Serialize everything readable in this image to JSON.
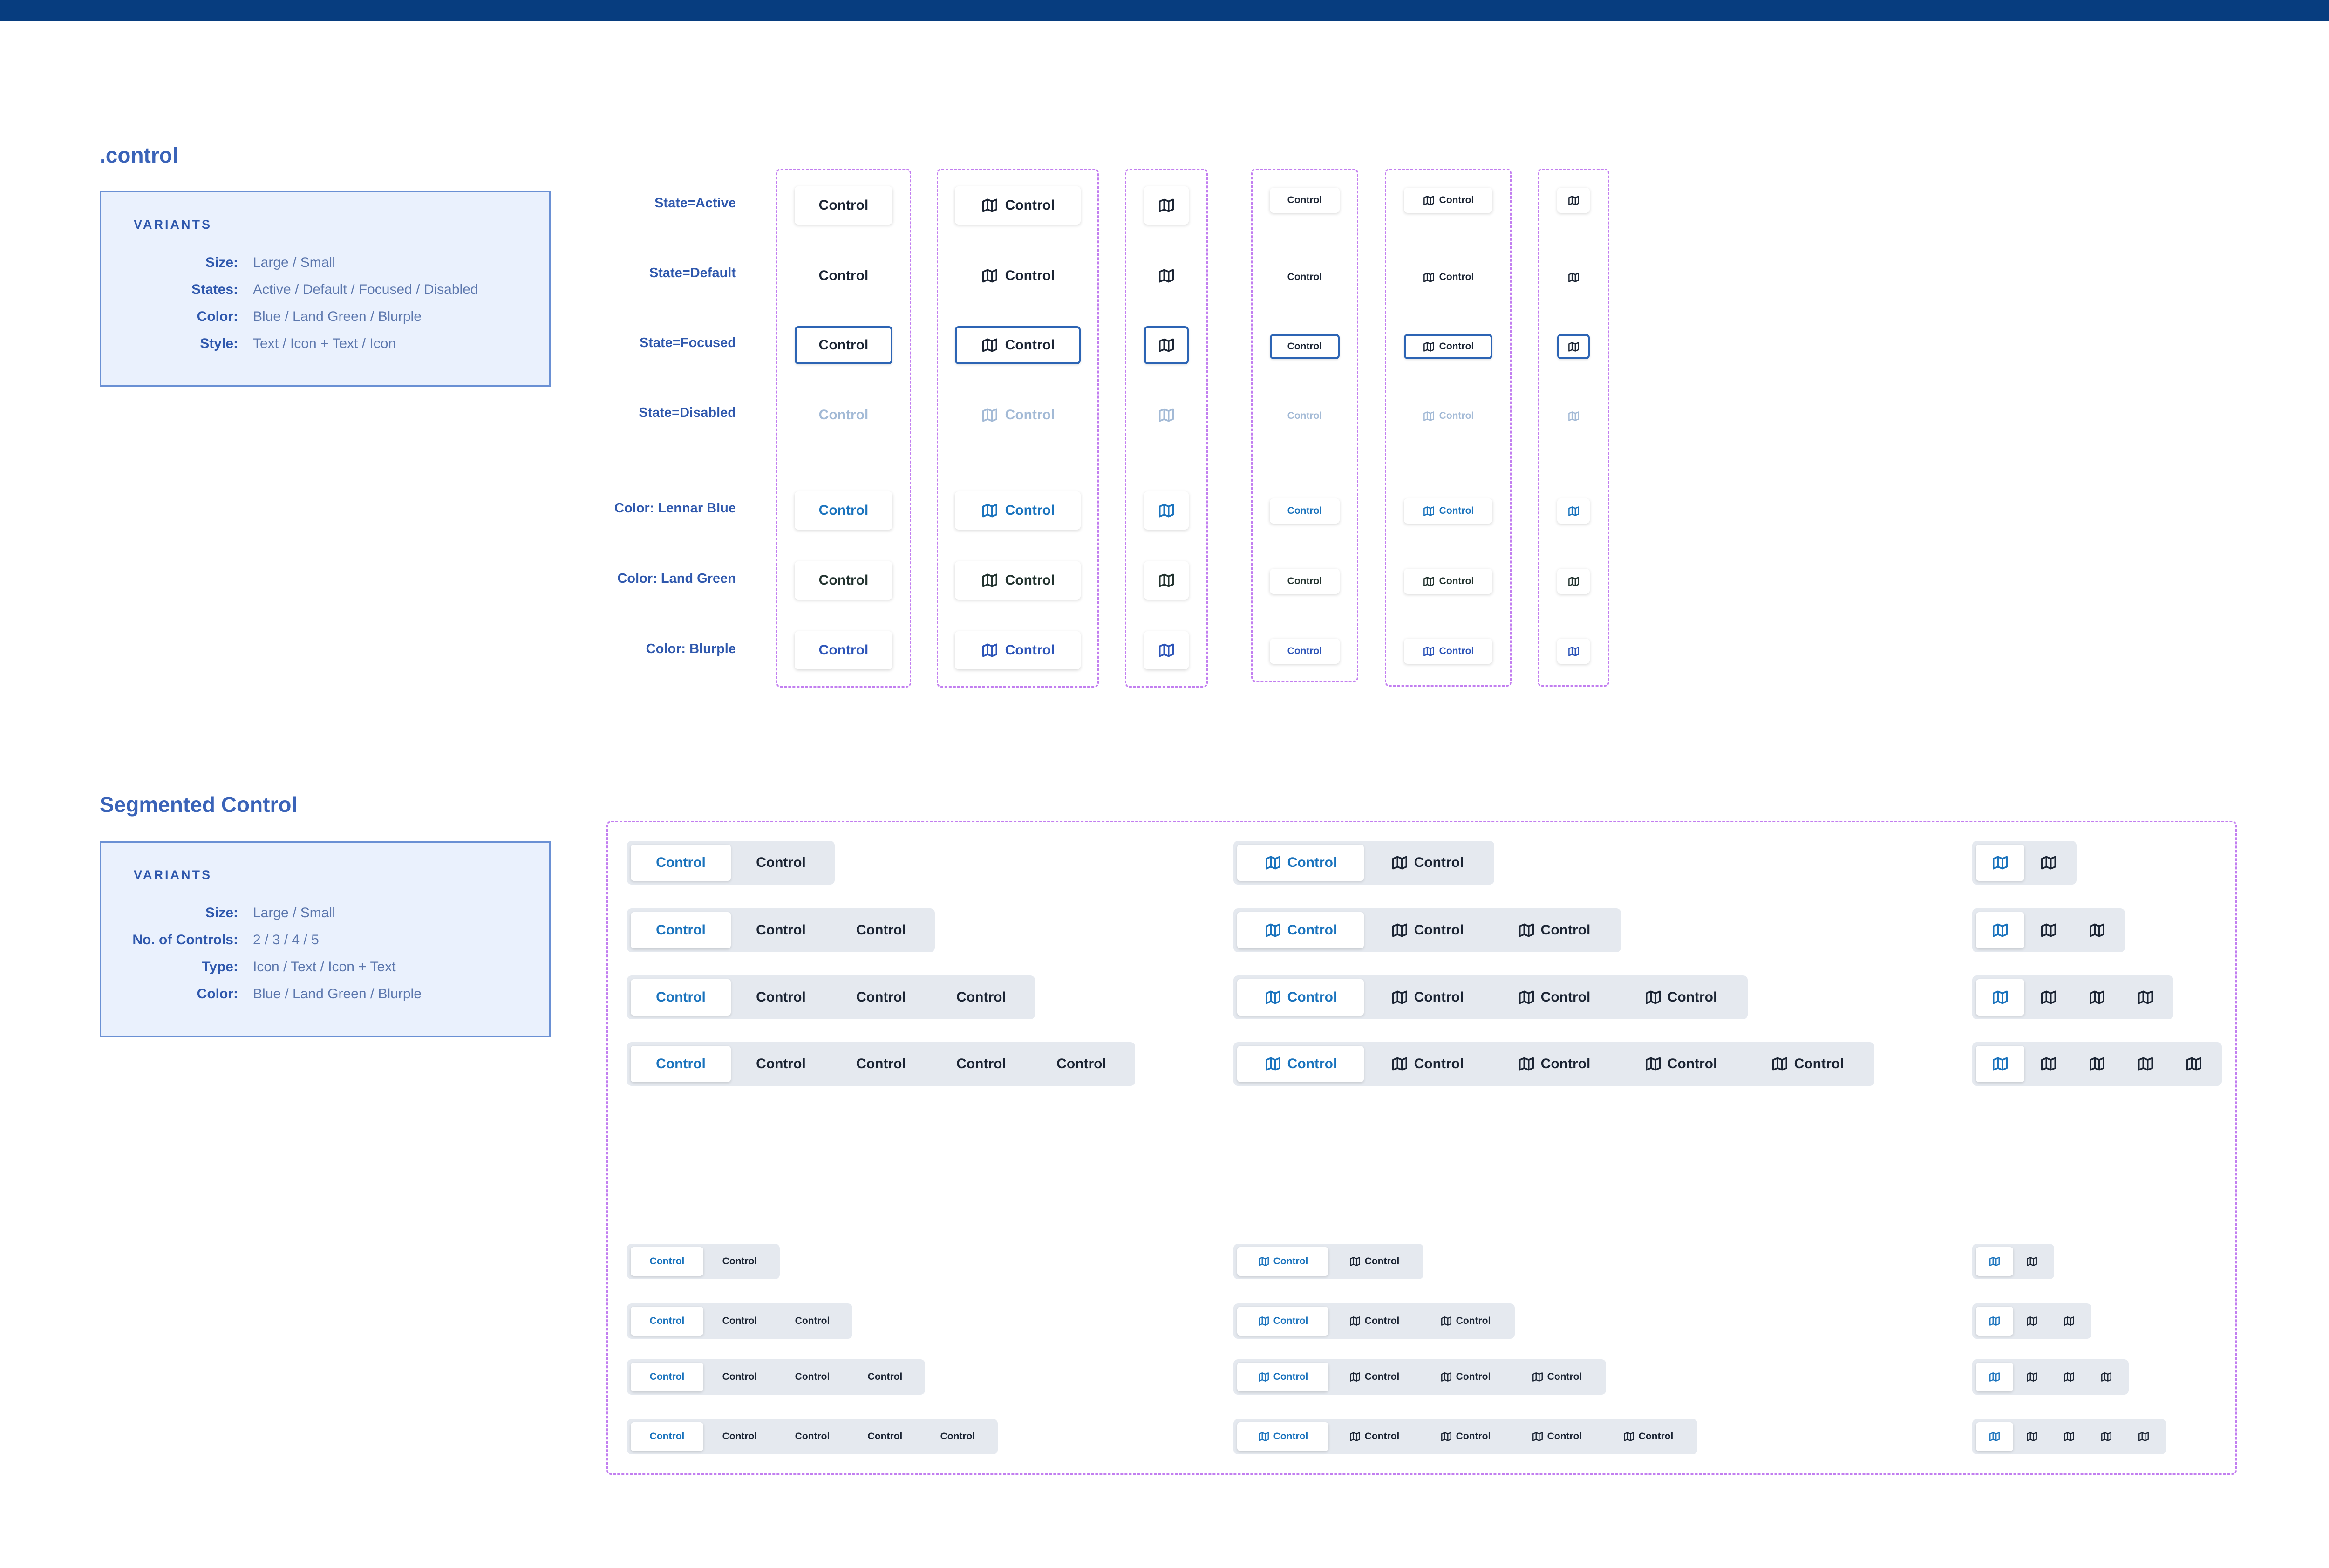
{
  "section_control": {
    "title": ".control",
    "variants_heading": "VARIANTS",
    "variants": [
      {
        "label": "Size:",
        "value": "Large / Small"
      },
      {
        "label": "States:",
        "value": "Active / Default / Focused / Disabled"
      },
      {
        "label": "Color:",
        "value": "Blue / Land Green / Blurple"
      },
      {
        "label": "Style:",
        "value": "Text / Icon + Text / Icon"
      }
    ],
    "row_labels": [
      "State=Active",
      "State=Default",
      "State=Focused",
      "State=Disabled",
      "Color: Lennar Blue",
      "Color: Land Green",
      "Color: Blurple"
    ],
    "control_label": "Control",
    "icon": "map-icon"
  },
  "section_segmented": {
    "title": "Segmented Control",
    "variants_heading": "VARIANTS",
    "variants": [
      {
        "label": "Size:",
        "value": "Large / Small"
      },
      {
        "label": "No. of Controls:",
        "value": "2 / 3 / 4 / 5"
      },
      {
        "label": "Type:",
        "value": "Icon / Text / Icon + Text"
      },
      {
        "label": "Color:",
        "value": "Blue / Land Green / Blurple"
      }
    ],
    "control_label": "Control",
    "counts": [
      2,
      3,
      4,
      5
    ],
    "icon": "map-icon"
  },
  "colors": {
    "header_bar": "#073d7f",
    "active_blue": "#1a73bd",
    "focus_border": "#2c64b4",
    "dashed_outline": "#c27ef0",
    "variants_bg": "#eaf1fd"
  }
}
